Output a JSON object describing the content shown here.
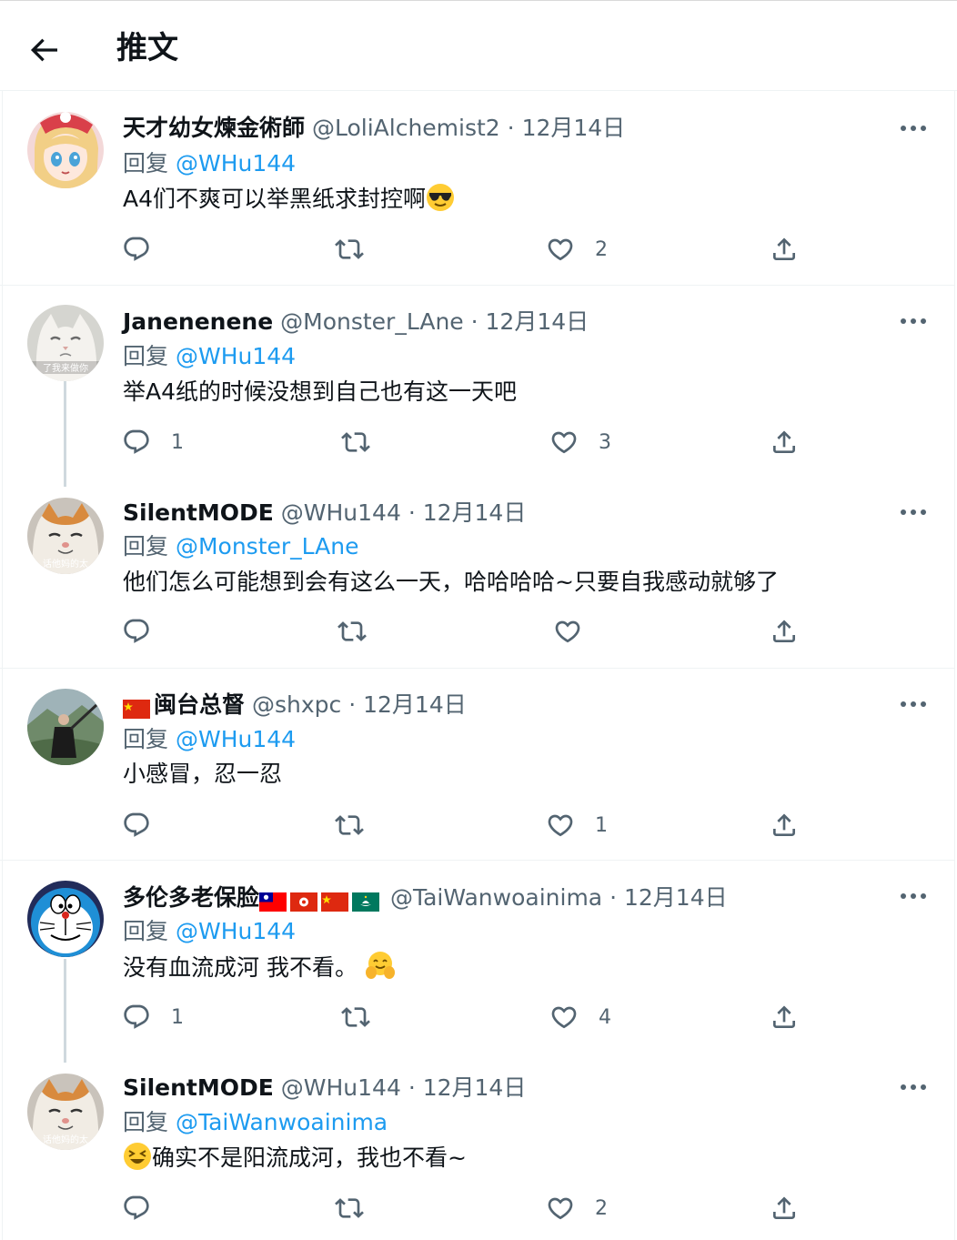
{
  "header": {
    "title": "推文",
    "back_icon": "arrow-left-icon"
  },
  "tweets": [
    {
      "name": "天才幼女煉金術師",
      "handle": "@LoliAlchemist2",
      "date": "12月14日",
      "reply_prefix": "回复",
      "reply_to": "@WHu144",
      "text": "A4们不爽可以举黑纸求封控啊",
      "emoji_after": "sunglasses-emoji",
      "replies": "",
      "retweets": "",
      "likes": "2"
    },
    {
      "name": "Janenenene",
      "handle": "@Monster_LAne",
      "date": "12月14日",
      "reply_prefix": "回复",
      "reply_to": "@WHu144",
      "text": "举A4纸的时候没想到自己也有这一天吧",
      "avatar_caption": "了我来做你",
      "replies": "1",
      "retweets": "",
      "likes": "3"
    },
    {
      "name": "SilentMODE",
      "handle": "@WHu144",
      "date": "12月14日",
      "reply_prefix": "回复",
      "reply_to": "@Monster_LAne",
      "text": "他们怎么可能想到会有这么一天，哈哈哈哈~只要自我感动就够了",
      "avatar_caption": "话他妈的太",
      "replies": "",
      "retweets": "",
      "likes": ""
    },
    {
      "name": "闽台总督",
      "name_flags": [
        "china-flag"
      ],
      "handle": "@shxpc",
      "date": "12月14日",
      "reply_prefix": "回复",
      "reply_to": "@WHu144",
      "text": "小感冒，忍一忍",
      "replies": "",
      "retweets": "",
      "likes": "1"
    },
    {
      "name": "多伦多老保脸",
      "name_flags": [
        "taiwan-flag",
        "hong-kong-flag",
        "china-flag",
        "macau-flag"
      ],
      "handle": "@TaiWanwoainima",
      "date": "12月14日",
      "reply_prefix": "回复",
      "reply_to": "@WHu144",
      "text": "没有血流成河 我不看。",
      "emoji_after": "hugging-face-emoji",
      "replies": "1",
      "retweets": "",
      "likes": "4"
    },
    {
      "name": "SilentMODE",
      "handle": "@WHu144",
      "date": "12月14日",
      "reply_prefix": "回复",
      "reply_to": "@TaiWanwoainima",
      "text": "确实不是阳流成河，我也不看~",
      "emoji_before": "laughing-squint-emoji",
      "avatar_caption": "话他妈的太",
      "replies": "",
      "retweets": "",
      "likes": "2"
    }
  ],
  "colors": {
    "link": "#1d9bf0",
    "secondary": "#536471",
    "primary": "#0f1419",
    "divider": "#eff3f4",
    "thread_line": "#cfd9de"
  }
}
